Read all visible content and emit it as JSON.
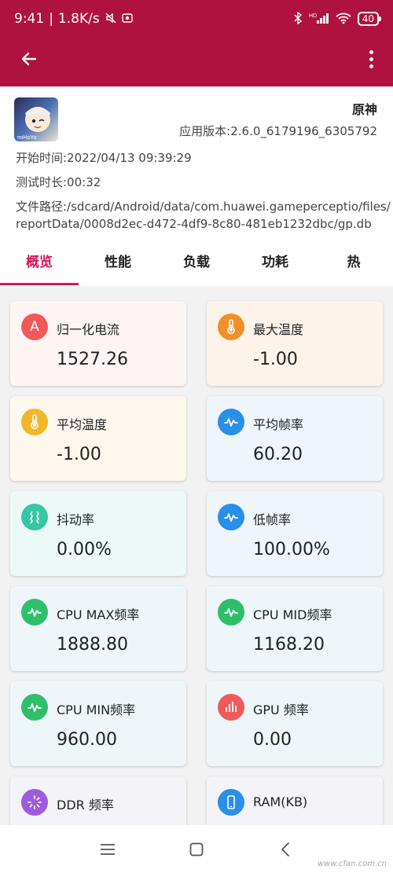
{
  "status_bar": {
    "time": "9:41",
    "net_speed": "1.8K/s",
    "signal_label": "HD",
    "battery": "40"
  },
  "game": {
    "name": "原神",
    "app_version": "应用版本:2.6.0_6179196_6305792",
    "icon_text": "miHoYo",
    "start_time": "开始时间:2022/04/13 09:39:29",
    "duration": "测试时长:00:32",
    "file_path_line1": "文件路径:/sdcard/Android/data/com.huawei.gameperceptio/files/",
    "file_path_line2": "reportData/0008d2ec-d472-4df9-8c80-481eb1232dbc/gp.db"
  },
  "tabs": [
    {
      "label": "概览",
      "active": true
    },
    {
      "label": "性能",
      "active": false
    },
    {
      "label": "负载",
      "active": false
    },
    {
      "label": "功耗",
      "active": false
    },
    {
      "label": "热",
      "active": false
    }
  ],
  "cards": [
    {
      "label": "归一化电流",
      "value": "1527.26",
      "icon": "a-letter-icon",
      "icon_text": "A",
      "icon_color": "#f25a5a",
      "bg": "#fdf4f4"
    },
    {
      "label": "最大温度",
      "value": "-1.00",
      "icon": "thermometer-icon",
      "icon_color": "#f0902a",
      "bg": "#fdf3ea"
    },
    {
      "label": "平均温度",
      "value": "-1.00",
      "icon": "thermometer-icon",
      "icon_color": "#f2b62a",
      "bg": "#fdf7ee"
    },
    {
      "label": "平均帧率",
      "value": "60.20",
      "icon": "pulse-icon",
      "icon_color": "#2a8fe8",
      "bg": "#eef5fb"
    },
    {
      "label": "抖动率",
      "value": "0.00%",
      "icon": "jitter-icon",
      "icon_color": "#35c7a3",
      "bg": "#edf9f6"
    },
    {
      "label": "低帧率",
      "value": "100.00%",
      "icon": "pulse-icon",
      "icon_color": "#2a8fe8",
      "bg": "#eef5fb"
    },
    {
      "label": "CPU MAX频率",
      "value": "1888.80",
      "icon": "pulse-icon",
      "icon_color": "#2fbf6b",
      "bg": "#eef6fa"
    },
    {
      "label": "CPU MID频率",
      "value": "1168.20",
      "icon": "pulse-icon",
      "icon_color": "#2fbf6b",
      "bg": "#eef6fa"
    },
    {
      "label": "CPU MIN频率",
      "value": "960.00",
      "icon": "pulse-icon",
      "icon_color": "#2fbf6b",
      "bg": "#eef6fa"
    },
    {
      "label": "GPU 频率",
      "value": "0.00",
      "icon": "bar-chart-icon",
      "icon_color": "#f25a5a",
      "bg": "#eef6fa"
    },
    {
      "label": "DDR 频率",
      "value": "",
      "icon": "spinner-icon",
      "icon_color": "#a05ae0",
      "bg": "#f4f4f8"
    },
    {
      "label": "RAM(KB)",
      "value": "",
      "icon": "phone-icon",
      "icon_color": "#2a8fe8",
      "bg": "#f4f4f8"
    }
  ],
  "watermark": "www.cfan.com.cn"
}
